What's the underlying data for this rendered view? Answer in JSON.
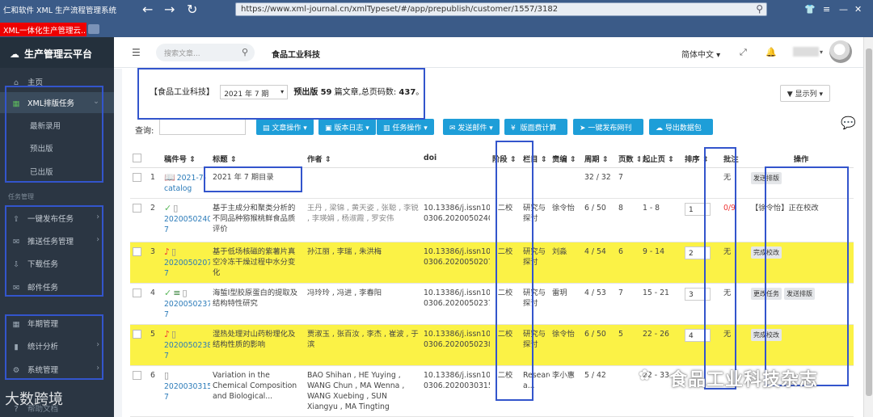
{
  "window": {
    "title": "仁和软件 XML 生产流程管理系统",
    "url": "https://www.xml-journal.cn/xmlTypeset/#/app/prepublish/customer/1557/3182",
    "tab_label": "XML一体化生产管理云..."
  },
  "sidebar": {
    "brand": "生产管理云平台",
    "items": [
      {
        "label": "主页",
        "icon": "home-icon"
      },
      {
        "label": "XML排版任务",
        "icon": "table-icon"
      }
    ],
    "subitems": [
      "最新录用",
      "预出版",
      "已出版"
    ],
    "section_label": "任务管理",
    "task_items": [
      {
        "label": "一键发布任务",
        "icon": "upload-icon"
      },
      {
        "label": "推送任务管理",
        "icon": "chat-icon"
      },
      {
        "label": "下载任务",
        "icon": "download-icon"
      },
      {
        "label": "邮件任务",
        "icon": "mail-icon"
      }
    ],
    "admin_items": [
      {
        "label": "年期管理",
        "icon": "grid-icon"
      },
      {
        "label": "统计分析",
        "icon": "bar-chart-icon"
      },
      {
        "label": "系统管理",
        "icon": "gear-icon"
      }
    ],
    "footer_label": "帮助文档"
  },
  "header": {
    "search_placeholder": "搜索文章...",
    "page_title": "食品工业科技",
    "language": "简体中文"
  },
  "info": {
    "journal": "【食品工业科技】",
    "issue": "2021 年 7 期",
    "summary_prefix": "预出版",
    "article_count": "59",
    "summary_mid": "篇文章,总页码数:",
    "page_total": "437",
    "summary_end": "。",
    "display_columns": "显示列"
  },
  "toolbar": {
    "query_label": "查询:",
    "buttons": [
      "文章操作",
      "版本日志",
      "任务操作",
      "发送邮件",
      "版面费计算",
      "一键发布网刊",
      "导出数据包"
    ]
  },
  "table": {
    "headers": [
      "稿件号",
      "标题",
      "作者",
      "doi",
      "阶段",
      "栏目",
      "责编",
      "周期",
      "页数",
      "起止页",
      "排序",
      "批注",
      "操作"
    ],
    "rows": [
      {
        "idx": "1",
        "id": "2021-7-catalog",
        "title": "2021 年 7 期目录",
        "authors": "",
        "doi": "",
        "stage": "",
        "column": "",
        "editor": "",
        "cycle": "32 / 32",
        "pages": "7",
        "range": "",
        "sort": "",
        "note": "无",
        "actions": [
          "发送排版"
        ],
        "highlight": false
      },
      {
        "idx": "2",
        "id": "2020050240-7",
        "title": "基于主成分和聚类分析的不同品种猕猴桃鲜食品质评价",
        "authors": "王丹 , 梁锦 , 黄天姿 , 张聪 , 李锐 , 李瑛娟 , 杨淑霞 , 罗安伟",
        "doi": "10.13386/j.issn1002-0306.2020050240",
        "stage": "二校",
        "column": "研究与探讨",
        "editor": "徐令怡",
        "cycle": "6 / 50",
        "pages": "8",
        "range": "1 - 8",
        "sort": "1",
        "note": "0/9",
        "actions": [
          "【徐令怡】正在校改"
        ],
        "highlight": false
      },
      {
        "idx": "3",
        "id": "2020050207-7",
        "title": "基于低场核磁的紫薯片真空冷冻干燥过程中水分变化",
        "authors": "孙江丽 , 李瑞 , 朱洪梅",
        "doi": "10.13386/j.issn1002-0306.2020050207",
        "stage": "二校",
        "column": "研究与探讨",
        "editor": "刘淼",
        "cycle": "4 / 54",
        "pages": "6",
        "range": "9 - 14",
        "sort": "2",
        "note": "无",
        "actions": [
          "完成校改"
        ],
        "highlight": true
      },
      {
        "idx": "4",
        "id": "2020050237-7",
        "title": "海蜇Ⅰ型胶原蛋白的提取及结构特性研究",
        "authors": "冯玲玲 , 冯进 , 李春阳",
        "doi": "10.13386/j.issn1002-0306.2020050237",
        "stage": "二校",
        "column": "研究与探讨",
        "editor": "雷玥",
        "cycle": "4 / 53",
        "pages": "7",
        "range": "15 - 21",
        "sort": "3",
        "note": "无",
        "actions": [
          "更改任务",
          "发送排版"
        ],
        "highlight": false
      },
      {
        "idx": "5",
        "id": "2020050238-7",
        "title": "湿热处理对山药粉理化及结构性质的影响",
        "authors": "贾淑玉 , 张百汝 , 李杰 , 崔波 , 于滨",
        "doi": "10.13386/j.issn1002-0306.2020050238",
        "stage": "二校",
        "column": "研究与探讨",
        "editor": "徐令怡",
        "cycle": "6 / 50",
        "pages": "5",
        "range": "22 - 26",
        "sort": "4",
        "note": "无",
        "actions": [
          "完成校改"
        ],
        "highlight": true
      },
      {
        "idx": "6",
        "id": "2020030315-7",
        "title": "Variation in the Chemical Composition and Biological...",
        "authors": "BAO Shihan , HE Yuying , WANG Chun , MA Wenna , WANG Xuebing , SUN Xiangyu , MA Tingting",
        "doi": "10.13386/j.issn1002-0306.2020030315",
        "stage": "二校",
        "column": "Research a...",
        "editor": "李小惠",
        "cycle": "5 / 42",
        "pages": "",
        "range": "22 - 33",
        "sort": "",
        "note": "",
        "actions": [],
        "highlight": false
      }
    ]
  },
  "watermarks": {
    "left": "大数跨境",
    "right": "食品工业科技杂志"
  },
  "colors": {
    "accent": "#1e9ed8",
    "highlight": "#fbf246",
    "annotation_box": "#3355cc",
    "sidebar": "#2b3643",
    "titlebar": "#3b5b88"
  }
}
